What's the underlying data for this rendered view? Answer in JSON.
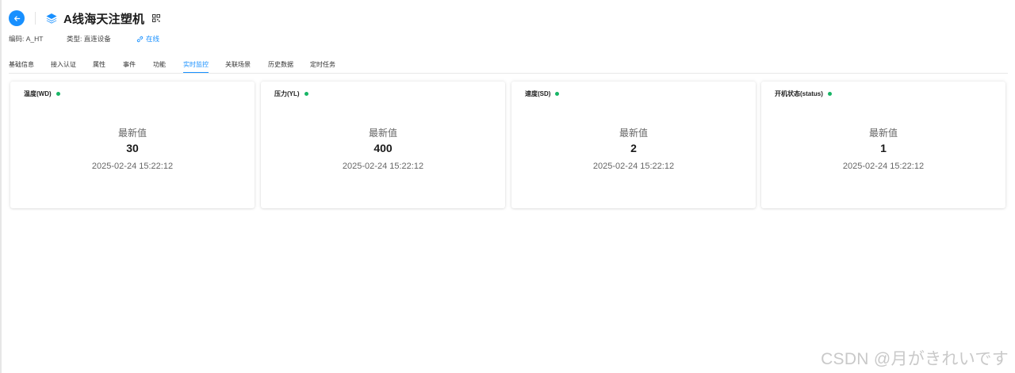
{
  "header": {
    "title": "A线海天注塑机",
    "back_icon": "arrow-left-icon",
    "device_icon": "layers-icon",
    "qr_icon": "qrcode-icon"
  },
  "meta": {
    "code": "编码: A_HT",
    "type": "类型: 直连设备",
    "status": "在线",
    "status_icon": "link-icon"
  },
  "tabs": [
    {
      "label": "基础信息",
      "active": false
    },
    {
      "label": "接入认证",
      "active": false
    },
    {
      "label": "属性",
      "active": false
    },
    {
      "label": "事件",
      "active": false
    },
    {
      "label": "功能",
      "active": false
    },
    {
      "label": "实时监控",
      "active": true
    },
    {
      "label": "关联场景",
      "active": false
    },
    {
      "label": "历史数据",
      "active": false
    },
    {
      "label": "定时任务",
      "active": false
    }
  ],
  "cards": [
    {
      "title": "温度(WD)",
      "label": "最新值",
      "value": "30",
      "time": "2025-02-24 15:22:12"
    },
    {
      "title": "压力(YL)",
      "label": "最新值",
      "value": "400",
      "time": "2025-02-24 15:22:12"
    },
    {
      "title": "速度(SD)",
      "label": "最新值",
      "value": "2",
      "time": "2025-02-24 15:22:12"
    },
    {
      "title": "开机状态(status)",
      "label": "最新值",
      "value": "1",
      "time": "2025-02-24 15:22:12"
    }
  ],
  "colors": {
    "accent": "#1890ff",
    "online_dot": "#18b566"
  },
  "watermark": "CSDN @月がきれいです"
}
